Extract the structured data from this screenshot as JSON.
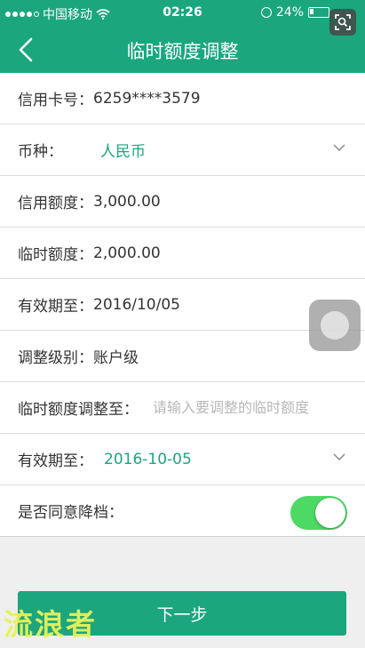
{
  "status_bar": {
    "carrier": "中国移动",
    "time": "02:26",
    "battery": "24%",
    "battery_level": 0.24
  },
  "nav": {
    "title": "临时额度调整"
  },
  "form": {
    "card": {
      "label": "信用卡号：",
      "value": "6259****3579"
    },
    "currency": {
      "label": "币种：",
      "value": "人民币"
    },
    "credit_limit": {
      "label": "信用额度：",
      "value": "3,000.00"
    },
    "temp_limit": {
      "label": "临时额度：",
      "value": "2,000.00"
    },
    "valid_until": {
      "label": "有效期至：",
      "value": "2016/10/05"
    },
    "adjust_level": {
      "label": "调整级别：",
      "value": "账户级"
    },
    "adjust_to": {
      "label": "临时额度调整至：",
      "placeholder": "请输入要调整的临时额度"
    },
    "new_valid_until": {
      "label": "有效期至：",
      "value": "2016-10-05"
    },
    "downgrade": {
      "label": "是否同意降档：",
      "on": true
    }
  },
  "next_button": {
    "label": "下一步"
  },
  "watermark": "流浪者",
  "colors": {
    "primary": "#1ba67e",
    "toggle_on": "#4cd964"
  }
}
